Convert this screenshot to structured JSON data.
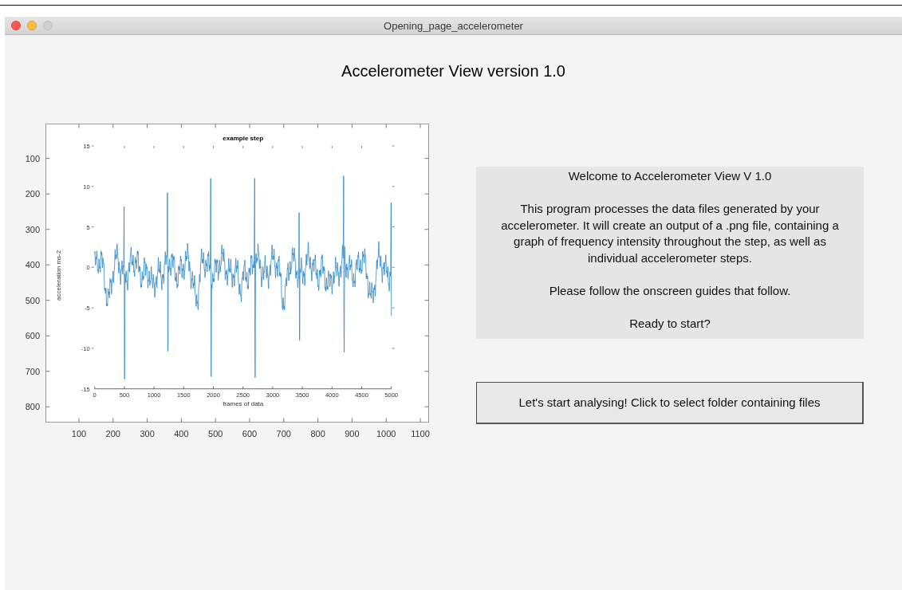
{
  "window": {
    "title": "Opening_page_accelerometer",
    "controls": [
      {
        "kind": "close",
        "disabled": false
      },
      {
        "kind": "minimize",
        "disabled": false
      },
      {
        "kind": "zoom",
        "disabled": true
      }
    ]
  },
  "heading": "Accelerometer View version 1.0",
  "image_axes": {
    "xticks": [
      "100",
      "200",
      "300",
      "400",
      "500",
      "600",
      "700",
      "800",
      "900",
      "1000",
      "1100"
    ],
    "yticks": [
      "100",
      "200",
      "300",
      "400",
      "500",
      "600",
      "700",
      "800"
    ],
    "plot": {
      "title": "example step",
      "xlabel": "frames of data",
      "ylabel": "acceleration ms-2",
      "xticks": [
        "0",
        "500",
        "1000",
        "1500",
        "2000",
        "2500",
        "3000",
        "3500",
        "4000",
        "4500",
        "5000"
      ],
      "yticks": [
        "15",
        "10",
        "5",
        "0",
        "-5",
        "-10",
        "-15"
      ]
    }
  },
  "info_panel": {
    "welcome": "Welcome to Accelerometer View V 1.0",
    "description": "This program processes the data files generated by your accelerometer.  It will create an output of a .png file, containing a graph of frequency intensity throughout the step, as well as individual accelerometer steps.",
    "instruction": "Please follow the onscreen guides that follow.",
    "prompt": "Ready to start?"
  },
  "start_button": {
    "label": "Let's start analysing!  Click to select folder containing files"
  }
}
